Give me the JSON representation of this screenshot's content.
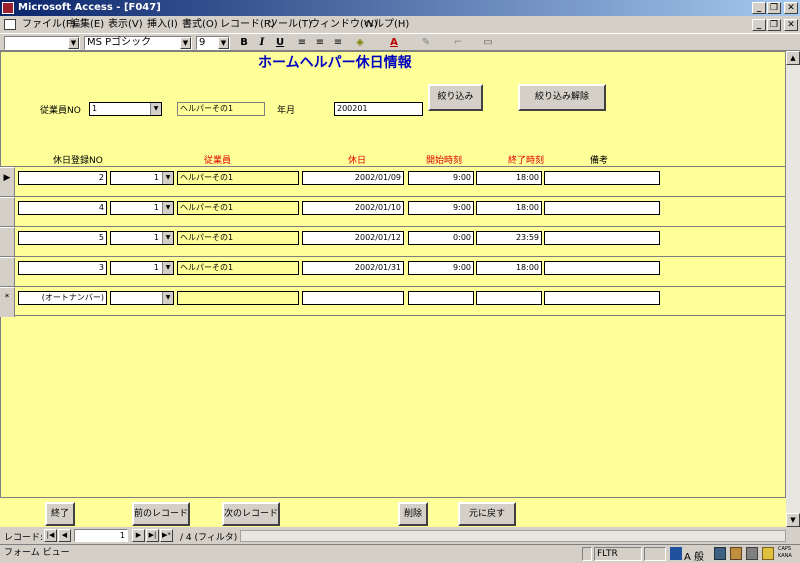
{
  "window": {
    "title": "Microsoft Access - [F047]"
  },
  "menu": [
    "ファイル(F)",
    "編集(E)",
    "表示(V)",
    "挿入(I)",
    "書式(O)",
    "レコード(R)",
    "ツール(T)",
    "ウィンドウ(W)",
    "ヘルプ(H)"
  ],
  "toolbar": {
    "font": "MS Pゴシック",
    "size": "9",
    "bold": "B",
    "italic": "I",
    "underline": "U"
  },
  "form": {
    "title": "ホームヘルパー休日情報",
    "filter": {
      "employee_label": "従業員NO",
      "employee_value": "1",
      "employee_name": "ヘルパーその1",
      "month_label": "年月",
      "month_value": "200201",
      "filter_button": "絞り込み",
      "clear_filter_button": "絞り込み解除"
    },
    "columns": [
      "休日登録NO",
      "従業員",
      "休日",
      "開始時刻",
      "終了時刻",
      "備考"
    ],
    "rows": [
      {
        "no": "2",
        "emp": "1",
        "name": "ヘルパーその1",
        "date": "2002/01/09",
        "start": "9:00",
        "end": "18:00",
        "note": ""
      },
      {
        "no": "4",
        "emp": "1",
        "name": "ヘルパーその1",
        "date": "2002/01/10",
        "start": "9:00",
        "end": "18:00",
        "note": ""
      },
      {
        "no": "5",
        "emp": "1",
        "name": "ヘルパーその1",
        "date": "2002/01/12",
        "start": "0:00",
        "end": "23:59",
        "note": ""
      },
      {
        "no": "3",
        "emp": "1",
        "name": "ヘルパーその1",
        "date": "2002/01/31",
        "start": "9:00",
        "end": "18:00",
        "note": ""
      }
    ],
    "new_row": {
      "marker": "*",
      "no": "(オートナンバー)"
    },
    "footer": {
      "close": "終了",
      "prev": "前のレコード",
      "next": "次のレコード",
      "delete": "削除",
      "undo": "元に戻す"
    }
  },
  "nav": {
    "label": "レコード:",
    "current": "1",
    "total": "/ 4 (フィルタ)"
  },
  "status": {
    "view": "フォーム ビュー",
    "fltr": "FLTR",
    "ime": "A 般",
    "caps": "CAPS",
    "kana": "KANA"
  }
}
